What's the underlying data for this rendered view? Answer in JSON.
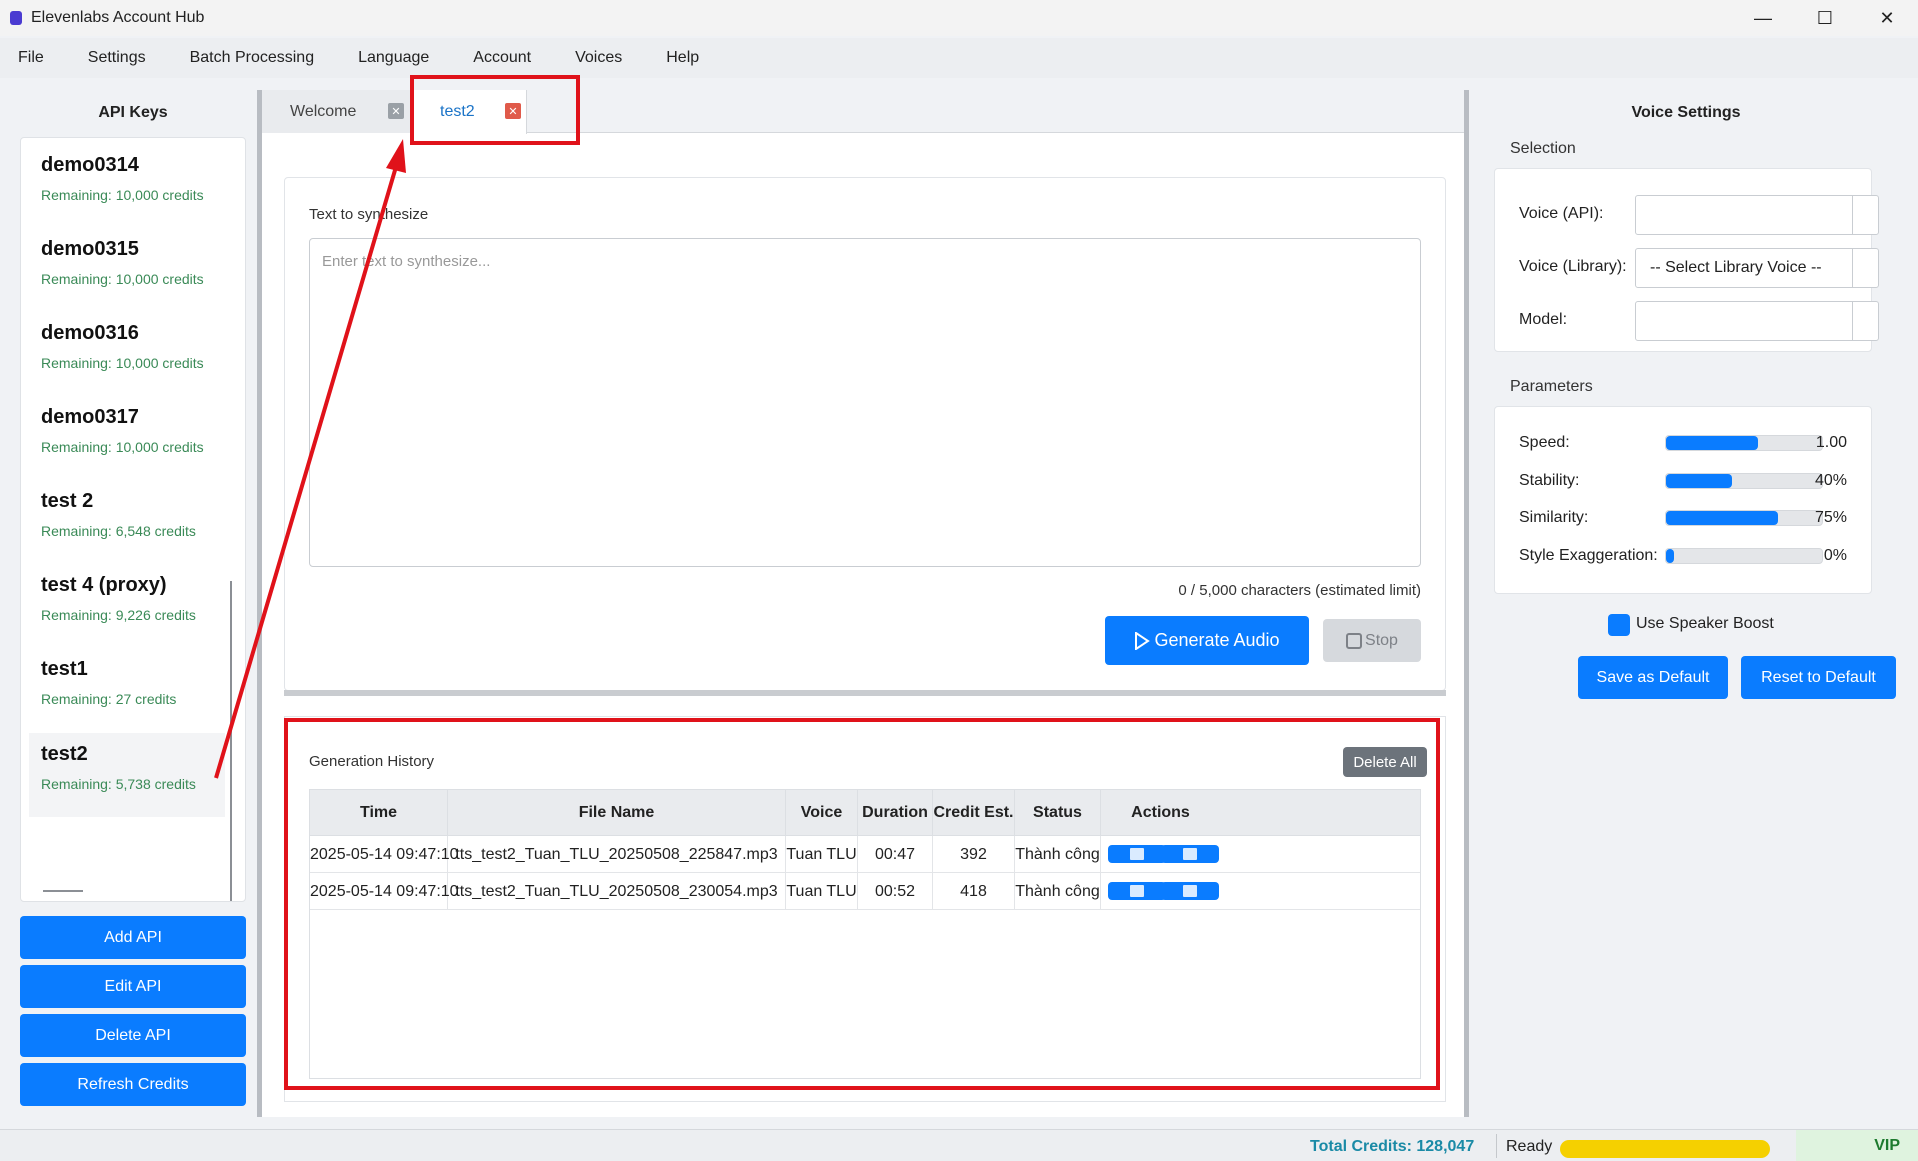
{
  "window": {
    "title": "Elevenlabs Account Hub",
    "minimize": "—",
    "maximize": "☐",
    "close": "✕"
  },
  "menu": [
    "File",
    "Settings",
    "Batch Processing",
    "Language",
    "Account",
    "Voices",
    "Help"
  ],
  "api_keys": {
    "title": "API Keys",
    "items": [
      {
        "name": "demo0314",
        "credits": "Remaining: 10,000 credits"
      },
      {
        "name": "demo0315",
        "credits": "Remaining: 10,000 credits"
      },
      {
        "name": "demo0316",
        "credits": "Remaining: 10,000 credits"
      },
      {
        "name": "demo0317",
        "credits": "Remaining: 10,000 credits"
      },
      {
        "name": "test 2",
        "credits": "Remaining: 6,548 credits"
      },
      {
        "name": "test 4 (proxy)",
        "credits": "Remaining: 9,226 credits"
      },
      {
        "name": "test1",
        "credits": "Remaining: 27 credits"
      },
      {
        "name": "test2",
        "credits": "Remaining: 5,738 credits"
      }
    ],
    "buttons": {
      "add": "Add API",
      "edit": "Edit API",
      "delete": "Delete API",
      "refresh": "Refresh Credits"
    }
  },
  "tabs": [
    {
      "label": "Welcome",
      "close": "✕"
    },
    {
      "label": "test2",
      "close": "✕"
    }
  ],
  "tts": {
    "label": "Text to synthesize",
    "placeholder": "Enter text to synthesize...",
    "char_count": "0 / 5,000 characters (estimated limit)",
    "generate_label": "Generate Audio",
    "stop_label": "Stop"
  },
  "history": {
    "title": "Generation History",
    "delete_all": "Delete All",
    "columns": [
      "Time",
      "File Name",
      "Voice",
      "Duration",
      "Credit Est.",
      "Status",
      "Actions"
    ],
    "rows": [
      [
        "2025-05-14 09:47:10",
        "tts_test2_Tuan_TLU_20250508_225847.mp3",
        "Tuan TLU",
        "00:47",
        "392",
        "Thành công"
      ],
      [
        "2025-05-14 09:47:10",
        "tts_test2_Tuan_TLU_20250508_230054.mp3",
        "Tuan TLU",
        "00:52",
        "418",
        "Thành công"
      ]
    ]
  },
  "voice_settings": {
    "title": "Voice Settings",
    "selection_title": "Selection",
    "voice_api_label": "Voice (API):",
    "voice_api_value": "",
    "voice_library_label": "Voice (Library):",
    "voice_library_value": "-- Select Library Voice --",
    "model_label": "Model:",
    "model_value": "",
    "parameters_title": "Parameters",
    "params": [
      {
        "label": "Speed:",
        "value": "1.00",
        "fraction": 0.59
      },
      {
        "label": "Stability:",
        "value": "40%",
        "fraction": 0.42
      },
      {
        "label": "Similarity:",
        "value": "75%",
        "fraction": 0.72
      },
      {
        "label": "Style Exaggeration:",
        "value": "0%",
        "fraction": 0.05
      }
    ],
    "speaker_boost_label": "Use Speaker Boost",
    "save_default": "Save as Default",
    "reset_default": "Reset to Default"
  },
  "status": {
    "total_credits": "Total Credits: 128,047",
    "ready": "Ready",
    "vip": "VIP"
  },
  "colors": {
    "accent": "#0a7cff",
    "annotation": "#e0121a",
    "credits_green": "#3a8a57"
  }
}
